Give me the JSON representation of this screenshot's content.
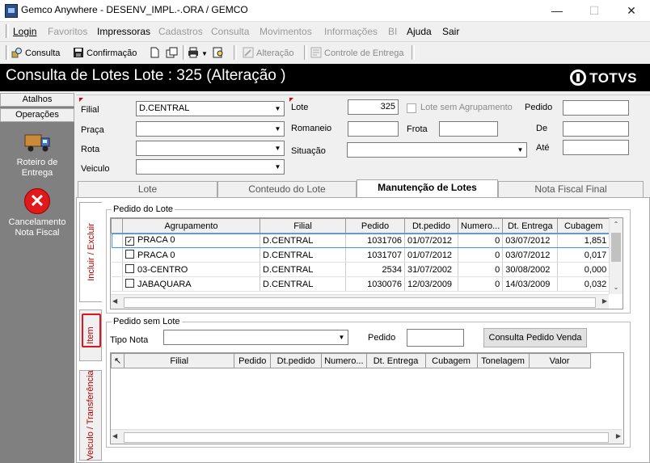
{
  "window": {
    "title": "Gemco Anywhere - DESENV_IMPL.-.ORA / GEMCO"
  },
  "menu": [
    "Login",
    "Favoritos",
    "Impressoras",
    "Cadastros",
    "Consulta",
    "Movimentos",
    "Informações",
    "BI",
    "Ajuda",
    "Sair"
  ],
  "toolbar": {
    "consulta": "Consulta",
    "confirmacao": "Confirmação",
    "alteracao": "Alteração",
    "controle": "Controle de Entrega"
  },
  "header": {
    "title": "Consulta de Lotes  Lote : 325  (Alteração )",
    "brand": "TOTVS"
  },
  "sidebar": {
    "tabs": [
      "Atalhos",
      "Operações"
    ],
    "actions": [
      {
        "label1": "Roteiro de",
        "label2": "Entrega"
      },
      {
        "label1": "Cancelamento",
        "label2": "Nota Fiscal"
      }
    ]
  },
  "form": {
    "filial_label": "Filial",
    "filial_value": "D.CENTRAL",
    "praca_label": "Praça",
    "rota_label": "Rota",
    "veiculo_label": "Veiculo",
    "lote_label": "Lote",
    "lote_value": "325",
    "lote_sem_agrup_label": "Lote sem Agrupamento",
    "romaneio_label": "Romaneio",
    "frota_label": "Frota",
    "situacao_label": "Situação",
    "pedido_label": "Pedido",
    "de_label": "De",
    "ate_label": "Até"
  },
  "tabs": [
    "Lote",
    "Conteudo do Lote",
    "Manutenção de Lotes",
    "Nota Fiscal Final"
  ],
  "vtabs": [
    "Incluir / Excluir",
    "Item",
    "Veiculo / Transferência"
  ],
  "pedido_lote": {
    "title": "Pedido do Lote",
    "columns": [
      "Agrupamento",
      "Filial",
      "Pedido",
      "Dt.pedido",
      "Numero...",
      "Dt. Entrega",
      "Cubagem"
    ],
    "rows": [
      {
        "checked": true,
        "agrupamento": "PRACA 0",
        "filial": "D.CENTRAL",
        "pedido": "1031706",
        "dt_pedido": "01/07/2012",
        "numero": "0",
        "dt_entrega": "03/07/2012",
        "cubagem": "1,851"
      },
      {
        "checked": false,
        "agrupamento": "PRACA 0",
        "filial": "D.CENTRAL",
        "pedido": "1031707",
        "dt_pedido": "01/07/2012",
        "numero": "0",
        "dt_entrega": "03/07/2012",
        "cubagem": "0,017"
      },
      {
        "checked": false,
        "agrupamento": "03-CENTRO",
        "filial": "D.CENTRAL",
        "pedido": "2534",
        "dt_pedido": "31/07/2002",
        "numero": "0",
        "dt_entrega": "30/08/2002",
        "cubagem": "0,000"
      },
      {
        "checked": false,
        "agrupamento": "JABAQUARA",
        "filial": "D.CENTRAL",
        "pedido": "1030076",
        "dt_pedido": "12/03/2009",
        "numero": "0",
        "dt_entrega": "14/03/2009",
        "cubagem": "0,032"
      }
    ]
  },
  "pedido_sem_lote": {
    "title": "Pedido sem Lote",
    "tipo_nota_label": "Tipo Nota",
    "pedido_label": "Pedido",
    "consulta_button": "Consulta Pedido Venda",
    "columns": [
      "Filial",
      "Pedido",
      "Dt.pedido",
      "Numero...",
      "Dt. Entrega",
      "Cubagem",
      "Tonelagem",
      "Valor"
    ]
  },
  "colors": {
    "header_bg": "#000000",
    "sidebar_bg": "#808080",
    "highlight": "#e0141e",
    "selected_row": "#3399ff"
  }
}
